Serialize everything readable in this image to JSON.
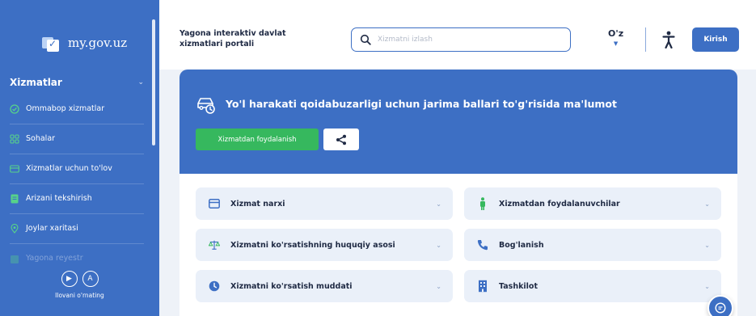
{
  "colors": {
    "brand_blue": "#3d6fc4",
    "green": "#36b85e",
    "panel_bg": "#eaf0f9"
  },
  "sidebar": {
    "logo_text": "my.gov.uz",
    "section_title": "Xizmatlar",
    "items": [
      {
        "label": "Ommabop xizmatlar",
        "icon": "check-circle-icon"
      },
      {
        "label": "Sohalar",
        "icon": "grid-icon"
      },
      {
        "label": "Xizmatlar uchun to'lov",
        "icon": "payment-card-icon"
      },
      {
        "label": "Arizani tekshirish",
        "icon": "document-icon"
      },
      {
        "label": "Joylar xaritasi",
        "icon": "map-pin-icon"
      },
      {
        "label": "Yagona reyestr",
        "icon": "registry-icon"
      }
    ],
    "bottom_label": "Ilovani o'rnating"
  },
  "header": {
    "portal_title": "Yagona interaktiv davlat\nxizmatlari portali",
    "search_placeholder": "Xizmatni izlash",
    "lang": "O'z",
    "login_label": "Kirish"
  },
  "service": {
    "title": "Yo'l harakati qoidabuzarligi uchun jarima ballari to'g'risida ma'lumot",
    "use_button": "Xizmatdan foydalanish",
    "accordion": [
      {
        "label": "Xizmat narxi",
        "icon": "wallet-icon"
      },
      {
        "label": "Xizmatdan foydalanuvchilar",
        "icon": "person-icon"
      },
      {
        "label": "Xizmatni ko'rsatishning huquqiy asosi",
        "icon": "scales-icon"
      },
      {
        "label": "Bog'lanish",
        "icon": "phone-icon"
      },
      {
        "label": "Xizmatni ko'rsatish muddati",
        "icon": "clock-icon"
      },
      {
        "label": "Tashkilot",
        "icon": "building-icon"
      }
    ]
  }
}
